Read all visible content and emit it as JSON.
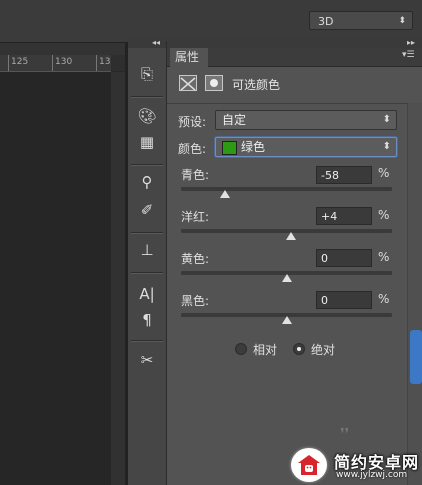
{
  "top_bar": {
    "workspace_value": "3D"
  },
  "ruler": {
    "ticks": [
      "125",
      "130",
      "13"
    ]
  },
  "panel": {
    "tab_label": "属性",
    "adjustment_title": "可选颜色",
    "preset": {
      "label": "预设:",
      "value": "自定"
    },
    "colors": {
      "label": "颜色:",
      "value": "绿色",
      "swatch_color": "#2c9a12"
    },
    "sliders": [
      {
        "label": "青色:",
        "value": "-58",
        "unit": "%",
        "level": -58
      },
      {
        "label": "洋红:",
        "value": "+4",
        "unit": "%",
        "level": 4
      },
      {
        "label": "黄色:",
        "value": "0",
        "unit": "%",
        "level": 0
      },
      {
        "label": "黑色:",
        "value": "0",
        "unit": "%",
        "level": 0
      }
    ],
    "method": {
      "relative_label": "相对",
      "absolute_label": "绝对",
      "selected": "absolute"
    }
  },
  "watermark": {
    "name": "简约安卓网",
    "url": "www.jylzwj.com"
  },
  "icons": [
    "collapse-left-icon",
    "collapse-right-icon",
    "history-icon",
    "palette-icon",
    "swatches-icon",
    "brush-presets-icon",
    "brush-icon",
    "clone-source-icon",
    "character-icon",
    "paragraph-icon",
    "tools-icon",
    "panel-menu-icon",
    "adjustment-icon",
    "mask-icon",
    "android-logo-icon"
  ],
  "colors": {
    "accent": "#3d78c7",
    "panel_bg": "#535353",
    "canvas_bg": "#262626"
  }
}
